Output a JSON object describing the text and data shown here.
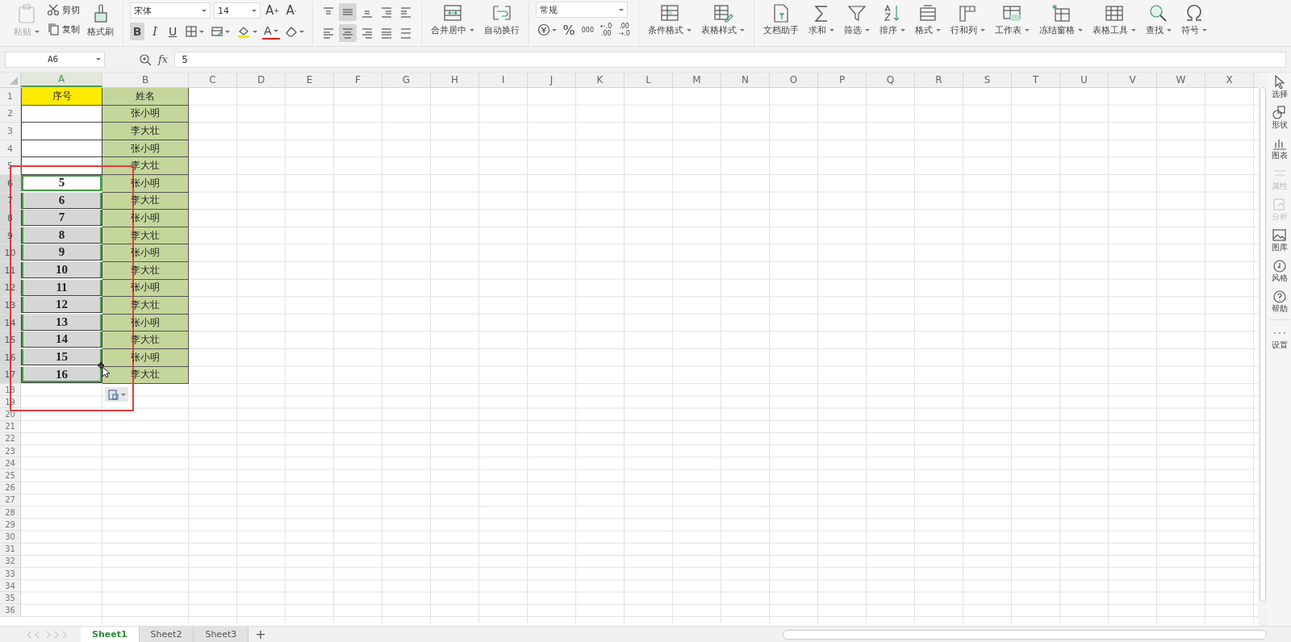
{
  "ribbon": [
    {
      "kind": "clipboard",
      "paste": {
        "label": "粘贴",
        "disabled": true,
        "dropdown": true
      },
      "cut": "剪切",
      "copy": "复制",
      "painter": "格式刷"
    },
    {
      "kind": "font",
      "font_name": "宋体",
      "font_size": "14",
      "grow": "A",
      "grow_sign": "+",
      "shrink": "A",
      "shrink_sign": "-",
      "bold": {
        "text": "B",
        "selected": true
      },
      "italic": {
        "text": "I",
        "selected": false
      },
      "underline": {
        "text": "U",
        "selected": false
      },
      "font_color": "A"
    },
    {
      "kind": "align",
      "buttons": [
        {
          "selected": false
        },
        {
          "selected": true
        },
        {
          "selected": false
        },
        {
          "selected": false
        },
        {
          "selected": false
        },
        {
          "selected": false
        },
        {
          "selected": true
        },
        {
          "selected": false
        },
        {
          "selected": false
        },
        {
          "selected": false
        }
      ]
    },
    {
      "kind": "large",
      "items": [
        {
          "label": "合并居中",
          "dropdown": true
        },
        {
          "label": "自动换行",
          "dropdown": false
        }
      ]
    },
    {
      "kind": "number",
      "format": "常规",
      "percent": "%",
      "thousands": "000",
      "increase_decimal": [
        "←.0",
        ".00"
      ],
      "decrease_decimal": [
        ".00",
        "→.0"
      ]
    },
    {
      "kind": "large",
      "items": [
        {
          "label": "条件格式",
          "dropdown": true
        },
        {
          "label": "表格样式",
          "dropdown": true
        }
      ]
    },
    {
      "kind": "large",
      "items": [
        {
          "label": "文档助手",
          "dropdown": false
        },
        {
          "label": "求和",
          "dropdown": true
        },
        {
          "label": "筛选",
          "dropdown": true
        },
        {
          "label": "排序",
          "dropdown": true
        },
        {
          "label": "格式",
          "dropdown": true
        },
        {
          "label": "行和列",
          "dropdown": true
        },
        {
          "label": "工作表",
          "dropdown": true
        },
        {
          "label": "冻结窗格",
          "dropdown": true
        },
        {
          "label": "表格工具",
          "dropdown": true
        },
        {
          "label": "查找",
          "dropdown": true
        },
        {
          "label": "符号",
          "dropdown": true
        }
      ]
    }
  ],
  "formula_bar": {
    "name_box": "A6",
    "fx": "fx",
    "value": "5"
  },
  "columns": [
    {
      "label": "A",
      "selected": true
    },
    {
      "label": "B",
      "selected": false
    },
    {
      "label": "C",
      "selected": false
    },
    {
      "label": "D",
      "selected": false
    },
    {
      "label": "E",
      "selected": false
    },
    {
      "label": "F",
      "selected": false
    },
    {
      "label": "G",
      "selected": false
    },
    {
      "label": "H",
      "selected": false
    },
    {
      "label": "I",
      "selected": false
    },
    {
      "label": "J",
      "selected": false
    },
    {
      "label": "K",
      "selected": false
    },
    {
      "label": "L",
      "selected": false
    },
    {
      "label": "M",
      "selected": false
    },
    {
      "label": "N",
      "selected": false
    },
    {
      "label": "O",
      "selected": false
    },
    {
      "label": "P",
      "selected": false
    },
    {
      "label": "Q",
      "selected": false
    },
    {
      "label": "R",
      "selected": false
    },
    {
      "label": "S",
      "selected": false
    },
    {
      "label": "T",
      "selected": false
    },
    {
      "label": "U",
      "selected": false
    },
    {
      "label": "V",
      "selected": false
    },
    {
      "label": "W",
      "selected": false
    },
    {
      "label": "X",
      "selected": false
    }
  ],
  "rows": [
    {
      "label": "1",
      "selected": false,
      "cells": [
        {
          "kind": "title",
          "text": "序号",
          "selected": false,
          "active": false
        },
        {
          "kind": "name",
          "text": "姓名",
          "selected": false,
          "active": false
        }
      ]
    },
    {
      "label": "2",
      "selected": false,
      "cells": [
        {
          "kind": "number",
          "selected": false,
          "active": false
        },
        {
          "kind": "name",
          "text": "张小明",
          "selected": false,
          "active": false
        }
      ]
    },
    {
      "label": "3",
      "selected": false,
      "cells": [
        {
          "kind": "number",
          "selected": false,
          "active": false
        },
        {
          "kind": "name",
          "text": "李大壮",
          "selected": false,
          "active": false
        }
      ]
    },
    {
      "label": "4",
      "selected": false,
      "cells": [
        {
          "kind": "number",
          "selected": false,
          "active": false
        },
        {
          "kind": "name",
          "text": "张小明",
          "selected": false,
          "active": false
        }
      ]
    },
    {
      "label": "5",
      "selected": false,
      "cells": [
        {
          "kind": "number",
          "selected": false,
          "active": false
        },
        {
          "kind": "name",
          "text": "李大壮",
          "selected": false,
          "active": false
        }
      ]
    },
    {
      "label": "6",
      "selected": true,
      "cells": [
        {
          "kind": "number",
          "text": "5",
          "selected": true,
          "active": true
        },
        {
          "kind": "name",
          "text": "张小明",
          "selected": false,
          "active": false
        }
      ]
    },
    {
      "label": "7",
      "selected": true,
      "cells": [
        {
          "kind": "number",
          "text": "6",
          "selected": true,
          "active": false
        },
        {
          "kind": "name",
          "text": "李大壮",
          "selected": false,
          "active": false
        }
      ]
    },
    {
      "label": "8",
      "selected": true,
      "cells": [
        {
          "kind": "number",
          "text": "7",
          "selected": true,
          "active": false
        },
        {
          "kind": "name",
          "text": "张小明",
          "selected": false,
          "active": false
        }
      ]
    },
    {
      "label": "9",
      "selected": true,
      "cells": [
        {
          "kind": "number",
          "text": "8",
          "selected": true,
          "active": false
        },
        {
          "kind": "name",
          "text": "李大壮",
          "selected": false,
          "active": false
        }
      ]
    },
    {
      "label": "10",
      "selected": true,
      "cells": [
        {
          "kind": "number",
          "text": "9",
          "selected": true,
          "active": false
        },
        {
          "kind": "name",
          "text": "张小明",
          "selected": false,
          "active": false
        }
      ]
    },
    {
      "label": "11",
      "selected": true,
      "cells": [
        {
          "kind": "number",
          "text": "10",
          "selected": true,
          "active": false
        },
        {
          "kind": "name",
          "text": "李大壮",
          "selected": false,
          "active": false
        }
      ]
    },
    {
      "label": "12",
      "selected": true,
      "cells": [
        {
          "kind": "number",
          "text": "11",
          "selected": true,
          "active": false
        },
        {
          "kind": "name",
          "text": "张小明",
          "selected": false,
          "active": false
        }
      ]
    },
    {
      "label": "13",
      "selected": true,
      "cells": [
        {
          "kind": "number",
          "text": "12",
          "selected": true,
          "active": false
        },
        {
          "kind": "name",
          "text": "李大壮",
          "selected": false,
          "active": false
        }
      ]
    },
    {
      "label": "14",
      "selected": true,
      "cells": [
        {
          "kind": "number",
          "text": "13",
          "selected": true,
          "active": false
        },
        {
          "kind": "name",
          "text": "张小明",
          "selected": false,
          "active": false
        }
      ]
    },
    {
      "label": "15",
      "selected": true,
      "cells": [
        {
          "kind": "number",
          "text": "14",
          "selected": true,
          "active": false
        },
        {
          "kind": "name",
          "text": "李大壮",
          "selected": false,
          "active": false
        }
      ]
    },
    {
      "label": "16",
      "selected": true,
      "cells": [
        {
          "kind": "number",
          "text": "15",
          "selected": true,
          "active": false
        },
        {
          "kind": "name",
          "text": "张小明",
          "selected": false,
          "active": false
        }
      ]
    },
    {
      "label": "17",
      "selected": true,
      "cells": [
        {
          "kind": "number",
          "text": "16",
          "selected": true,
          "active": false
        },
        {
          "kind": "name",
          "text": "李大壮",
          "selected": false,
          "active": false
        }
      ]
    },
    {
      "label": "18",
      "selected": false
    },
    {
      "label": "19",
      "selected": false
    },
    {
      "label": "20",
      "selected": false
    },
    {
      "label": "21",
      "selected": false
    },
    {
      "label": "22",
      "selected": false
    },
    {
      "label": "23",
      "selected": false
    },
    {
      "label": "24",
      "selected": false
    },
    {
      "label": "25",
      "selected": false
    },
    {
      "label": "26",
      "selected": false
    },
    {
      "label": "27",
      "selected": false
    },
    {
      "label": "28",
      "selected": false
    },
    {
      "label": "29",
      "selected": false
    },
    {
      "label": "30",
      "selected": false
    },
    {
      "label": "31",
      "selected": false
    },
    {
      "label": "32",
      "selected": false
    },
    {
      "label": "33",
      "selected": false
    },
    {
      "label": "34",
      "selected": false
    },
    {
      "label": "35",
      "selected": false
    },
    {
      "label": "36",
      "selected": false
    }
  ],
  "sidebar": [
    {
      "label": "选择",
      "disabled": false
    },
    {
      "label": "形状",
      "disabled": false
    },
    {
      "label": "图表",
      "disabled": false
    },
    {
      "label": "属性",
      "disabled": true
    },
    {
      "label": "分析",
      "disabled": true
    },
    {
      "label": "图库",
      "disabled": false
    },
    {
      "label": "风格",
      "disabled": false
    },
    {
      "label": "帮助",
      "disabled": false
    },
    {
      "label": "设置",
      "disabled": false
    }
  ],
  "sheet_tabs": [
    {
      "label": "Sheet1",
      "selected": true
    },
    {
      "label": "Sheet2",
      "selected": false
    },
    {
      "label": "Sheet3",
      "selected": false
    }
  ],
  "add_sheet": "+"
}
